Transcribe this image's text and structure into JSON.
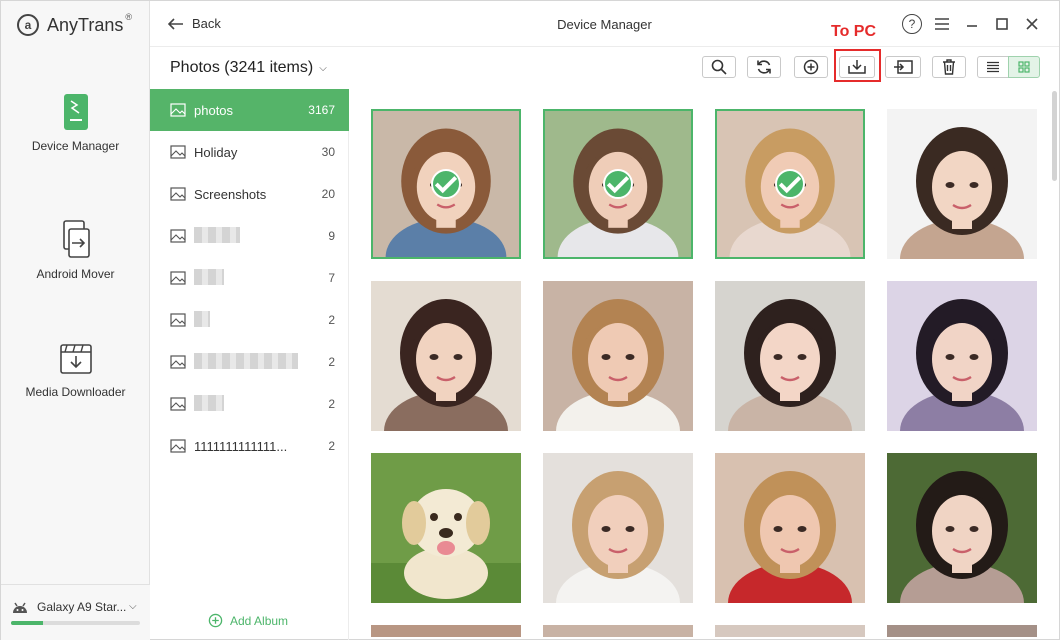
{
  "app": {
    "name": "AnyTrans",
    "reg": "®"
  },
  "nav": [
    {
      "label": "Device Manager",
      "icon": "phone-icon"
    },
    {
      "label": "Android Mover",
      "icon": "transfer-icon"
    },
    {
      "label": "Media Downloader",
      "icon": "download-icon"
    }
  ],
  "device": {
    "name": "Galaxy A9 Star...",
    "storage_used": 0.25
  },
  "topbar": {
    "back_label": "Back",
    "title": "Device Manager",
    "help": "?"
  },
  "album_header": {
    "title": "Photos (3241 items)"
  },
  "annotation": {
    "label": "To PC"
  },
  "albums": [
    {
      "name": "photos",
      "count": "3167",
      "active": true
    },
    {
      "name": "Holiday",
      "count": "30"
    },
    {
      "name": "Screenshots",
      "count": "20"
    },
    {
      "name": "",
      "count": "9",
      "blurred": true
    },
    {
      "name": "",
      "count": "7",
      "blurred": true
    },
    {
      "name": "",
      "count": "2",
      "blurred": true
    },
    {
      "name": "",
      "count": "2",
      "blurred": true
    },
    {
      "name": "",
      "count": "2",
      "blurred": true
    },
    {
      "name": "1111111111111...",
      "count": "2"
    }
  ],
  "add_album_label": "Add Album",
  "colors": {
    "accent": "#4cb56a",
    "annotation": "#e52b2b"
  },
  "photos": [
    {
      "selected": true,
      "bg": "#c9b8a8",
      "skin": "#f1d2bd",
      "hair": "#8a5a3a",
      "cloth": "#5b7fa8"
    },
    {
      "selected": true,
      "bg": "#9fb98c",
      "skin": "#efcdb8",
      "hair": "#6a4a35",
      "cloth": "#e7e7ea"
    },
    {
      "selected": true,
      "bg": "#d8c4b4",
      "skin": "#f0cbb5",
      "hair": "#c89c62",
      "cloth": "#e8d8cf"
    },
    {
      "selected": false,
      "bg": "#f3f3f3",
      "skin": "#f2d6c4",
      "hair": "#3a2a22",
      "cloth": "#c4a590"
    },
    {
      "selected": false,
      "bg": "#e4dcd2",
      "skin": "#f1d3c0",
      "hair": "#3a2520",
      "cloth": "#8a6d5f"
    },
    {
      "selected": false,
      "bg": "#c8b3a5",
      "skin": "#efcab4",
      "hair": "#b38352",
      "cloth": "#f3f1ec"
    },
    {
      "selected": false,
      "bg": "#d6d4cf",
      "skin": "#f3d6c7",
      "hair": "#2e211e",
      "cloth": "#c9b4a6"
    },
    {
      "selected": false,
      "bg": "#dcd4e6",
      "skin": "#f1d4c6",
      "hair": "#231b26",
      "cloth": "#8d7ea4"
    },
    {
      "selected": false,
      "bg": "#6f9c47",
      "skin": "#efe3c8",
      "hair": "#e4d2aa",
      "cloth": "#6f9c47"
    },
    {
      "selected": false,
      "bg": "#e4e0dc",
      "skin": "#f1cfbc",
      "hair": "#c7a071",
      "cloth": "#f4f3f1"
    },
    {
      "selected": false,
      "bg": "#d8c1b0",
      "skin": "#efc7b0",
      "hair": "#c09159",
      "cloth": "#c6282b"
    },
    {
      "selected": false,
      "bg": "#4d6a35",
      "skin": "#f0d4c4",
      "hair": "#231b17",
      "cloth": "#b59d94"
    }
  ]
}
